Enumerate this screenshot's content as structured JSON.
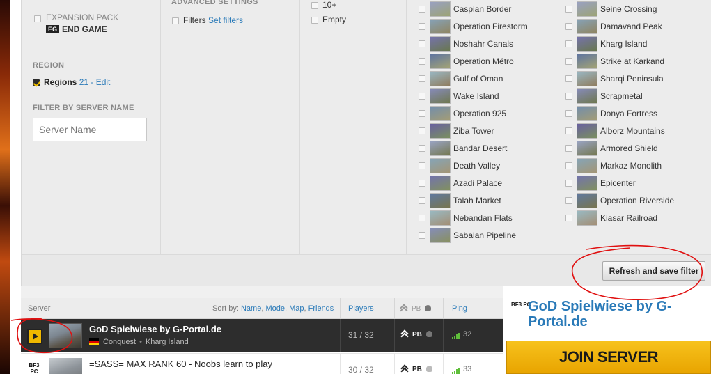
{
  "filters": {
    "expansion_pack": {
      "title": "EXPANSION PACK",
      "badge": "EG",
      "name": "END GAME"
    },
    "region": {
      "section": "REGION",
      "label": "Regions",
      "count": "21",
      "edit": " - Edit"
    },
    "server_name": {
      "section": "FILTER BY SERVER NAME",
      "placeholder": "Server Name"
    },
    "advanced": {
      "section": "ADVANCED SETTINGS",
      "filters_label": "Filters",
      "set_filters": "Set filters"
    },
    "slots": {
      "option1": "10+",
      "option2": "Empty"
    },
    "maps_col1": [
      "Caspian Border",
      "Operation Firestorm",
      "Noshahr Canals",
      "Operation Métro",
      "Gulf of Oman",
      "Wake Island",
      "Operation 925",
      "Ziba Tower",
      "Bandar Desert",
      "Death Valley",
      "Azadi Palace",
      "Talah Market",
      "Nebandan Flats",
      "Sabalan Pipeline"
    ],
    "maps_col2": [
      "Seine Crossing",
      "Damavand Peak",
      "Kharg Island",
      "Strike at Karkand",
      "Sharqi Peninsula",
      "Scrapmetal",
      "Donya Fortress",
      "Alborz Mountains",
      "Armored Shield",
      "Markaz Monolith",
      "Epicenter",
      "Operation Riverside",
      "Kiasar Railroad"
    ],
    "refresh_button": "Refresh and save filter"
  },
  "server_list": {
    "header": {
      "server": "Server",
      "sort_by": "Sort by:",
      "sort_options": [
        "Name",
        "Mode",
        "Map",
        "Friends"
      ],
      "players": "Players",
      "pb": "PB",
      "ping": "Ping"
    },
    "rows": [
      {
        "name": "GoD Spielwiese by G-Portal.de",
        "mode": "Conquest",
        "map": "Kharg Island",
        "players": "31 / 32",
        "pb": "PB",
        "ping": "32"
      },
      {
        "name": "=SASS= MAX RANK 60 - Noobs learn to play",
        "players": "30 / 32",
        "pb": "PB",
        "ping": "33"
      }
    ]
  },
  "side_panel": {
    "logo": "BF3 PC",
    "title": "GoD Spielwiese by G-Portal.de",
    "join_button": "JOIN SERVER"
  },
  "colors": {
    "accent_link": "#2a7ab8",
    "join_button": "#f2b400",
    "selected_row": "#2d2d2d",
    "annotation": "#e01010"
  }
}
